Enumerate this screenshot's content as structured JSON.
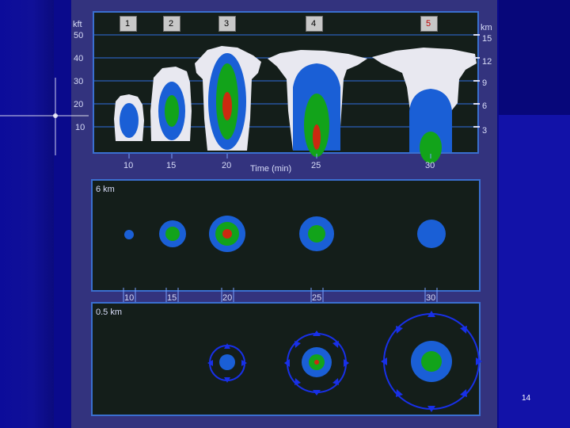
{
  "colors": {
    "background": "#0a0a8c",
    "panel": "#141e1a",
    "panel_border": "#3a6fd0",
    "anvil_white": "#e8e8f0",
    "echo_blue": "#1a5fd6",
    "echo_green": "#12a31a",
    "echo_red": "#cc2a10",
    "text": "#ffffff"
  },
  "top_panel": {
    "left_unit": "kft",
    "right_unit": "km",
    "left_ticks": [
      "50",
      "40",
      "30",
      "20",
      "10"
    ],
    "right_ticks": [
      "15",
      "12",
      "9",
      "6",
      "3"
    ],
    "time_ticks": [
      "10",
      "15",
      "20",
      "25",
      "30"
    ],
    "time_label": "Time (min)",
    "stage_buttons": [
      "1",
      "2",
      "3",
      "4",
      "5"
    ]
  },
  "middle_panel": {
    "label": "6 km",
    "time_ticks": [
      "10",
      "15",
      "20",
      "25",
      "30"
    ]
  },
  "bottom_panel": {
    "label": "0.5 km"
  },
  "slide_number": "14"
}
